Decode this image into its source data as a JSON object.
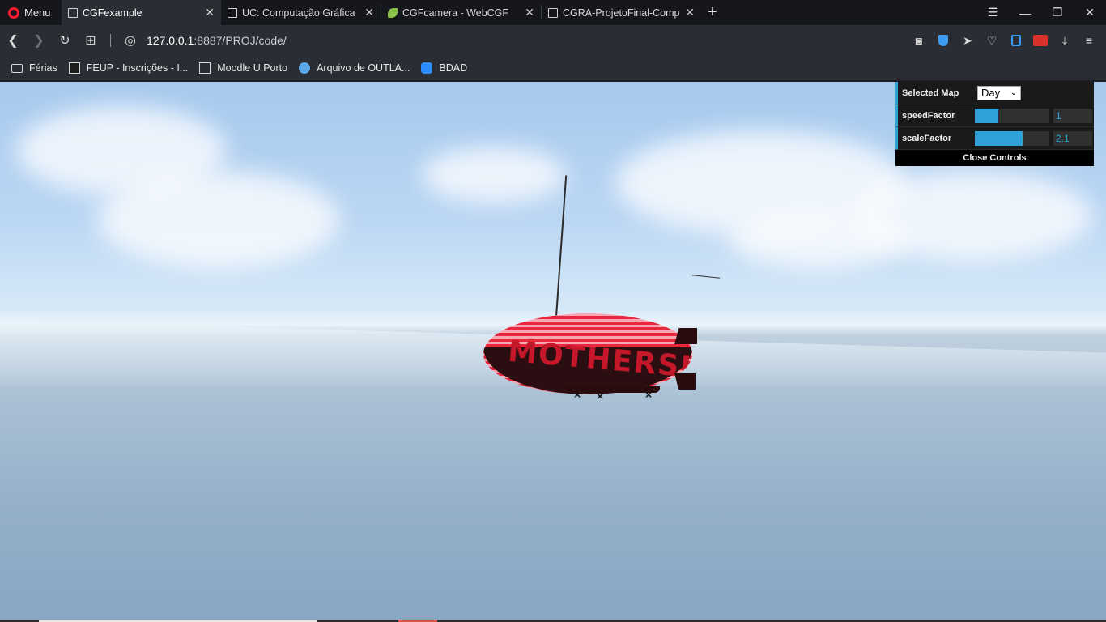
{
  "browser": {
    "menu_label": "Menu",
    "tabs": [
      {
        "label": "CGFexample",
        "active": true
      },
      {
        "label": "UC: Computação Gráfica",
        "active": false
      },
      {
        "label": "CGFcamera - WebCGF",
        "active": false
      },
      {
        "label": "CGRA-ProjetoFinal-Comple",
        "active": false
      }
    ],
    "url_host": "127.0.0.1",
    "url_path": ":8887/PROJ/code/"
  },
  "bookmarks": [
    {
      "label": "Férias",
      "icon": "folder-icon"
    },
    {
      "label": "FEUP - Inscrições - I...",
      "icon": "feup-icon"
    },
    {
      "label": "Moodle U.Porto",
      "icon": "page-icon"
    },
    {
      "label": "Arquivo de OUTLA...",
      "icon": "play-icon"
    },
    {
      "label": "BDAD",
      "icon": "zoom-icon"
    }
  ],
  "scene": {
    "blimp_text": "MOTHERSHI"
  },
  "controls": {
    "selected_map_label": "Selected Map",
    "selected_map_value": "Day",
    "speed_label": "speedFactor",
    "speed_value": "1",
    "speed_fraction": 0.32,
    "scale_label": "scaleFactor",
    "scale_value": "2.1",
    "scale_fraction": 0.64,
    "close_label": "Close Controls",
    "accent_color": "#2fa1d6"
  }
}
